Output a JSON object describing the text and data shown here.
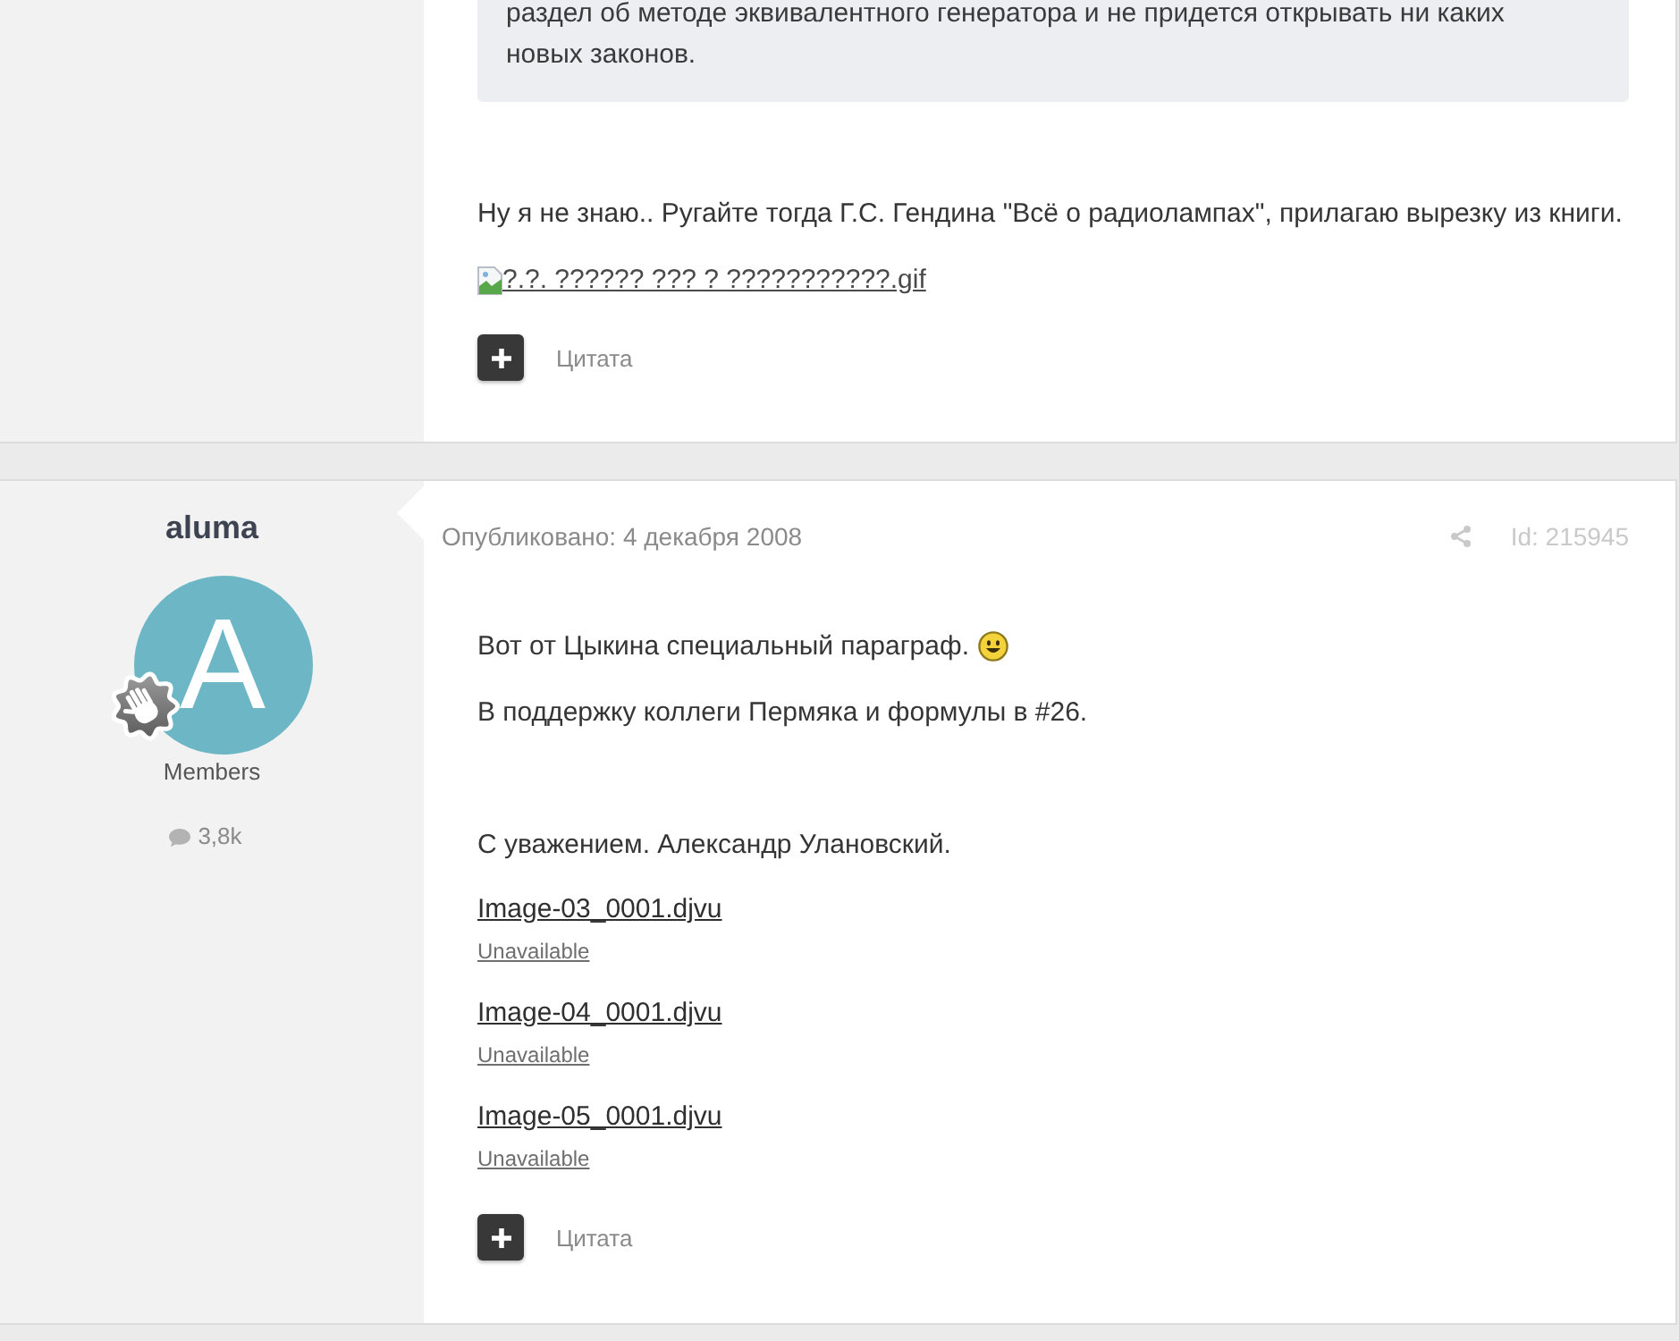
{
  "posts": [
    {
      "quote": "раздел об методе эквивалентного генератора и не придется открывать ни каких новых законов.",
      "sections": [
        {
          "paragraphs": [
            {
              "text": "Ну я не знаю.. Ругайте тогда Г.С. Гендина \"Всё о радиолампах\", прилагаю вырезку из книги."
            }
          ]
        }
      ],
      "broken_image": "?.?. ?????? ??? ? ???????????.gif",
      "quote_action": "Цитата"
    },
    {
      "author": {
        "name": "aluma",
        "avatar_letter": "A",
        "group": "Members",
        "posts_count": "3,8k"
      },
      "published": "Опубликовано: 4 декабря 2008",
      "post_id": "Id: 215945",
      "sections": [
        {
          "paragraphs": [
            {
              "text": "Вот от Цыкина специальный параграф.",
              "smiley": true
            },
            {
              "text": "В поддержку коллеги Пермяка и формулы в #26."
            }
          ]
        },
        {
          "paragraphs": [
            {
              "text": "С уважением. Александр Улановский."
            }
          ]
        }
      ],
      "attachments": [
        {
          "name": "Image-03_0001.djvu",
          "status": "Unavailable"
        },
        {
          "name": "Image-04_0001.djvu",
          "status": "Unavailable"
        },
        {
          "name": "Image-05_0001.djvu",
          "status": "Unavailable"
        }
      ],
      "quote_action": "Цитата"
    }
  ]
}
